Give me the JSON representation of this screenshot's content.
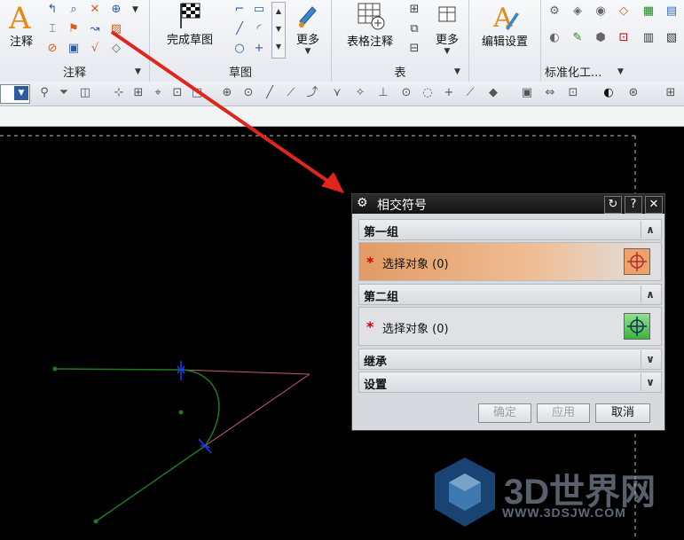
{
  "ribbon": {
    "annotation_group": {
      "big_label": "注释",
      "group_label": "注释"
    },
    "sketch_group": {
      "finish_label": "完成草图",
      "more_label": "更多",
      "group_label": "草图"
    },
    "table_group": {
      "table_note_label": "表格注释",
      "more_label": "更多",
      "group_label": "表"
    },
    "style_group": {
      "edit_settings_label": "编辑设置"
    },
    "std_group": {
      "group_label": "标准化工..."
    }
  },
  "dialog": {
    "title": "相交符号",
    "section1": {
      "header": "第一组",
      "select_label": "选择对象 (0)"
    },
    "section2": {
      "header": "第二组",
      "select_label": "选择对象 (0)"
    },
    "inherit_header": "继承",
    "settings_header": "设置",
    "buttons": {
      "ok": "确定",
      "apply": "应用",
      "cancel": "取消"
    }
  },
  "watermark": {
    "name": "3D世界网",
    "url": "WWW.3DSJW.COM"
  },
  "colors": {
    "accent_orange": "#e39a62",
    "curve_green": "#1f7a1f",
    "line_pink": "#c06070",
    "arrow_red": "#e0261b",
    "blue_mark": "#1a3cff"
  }
}
